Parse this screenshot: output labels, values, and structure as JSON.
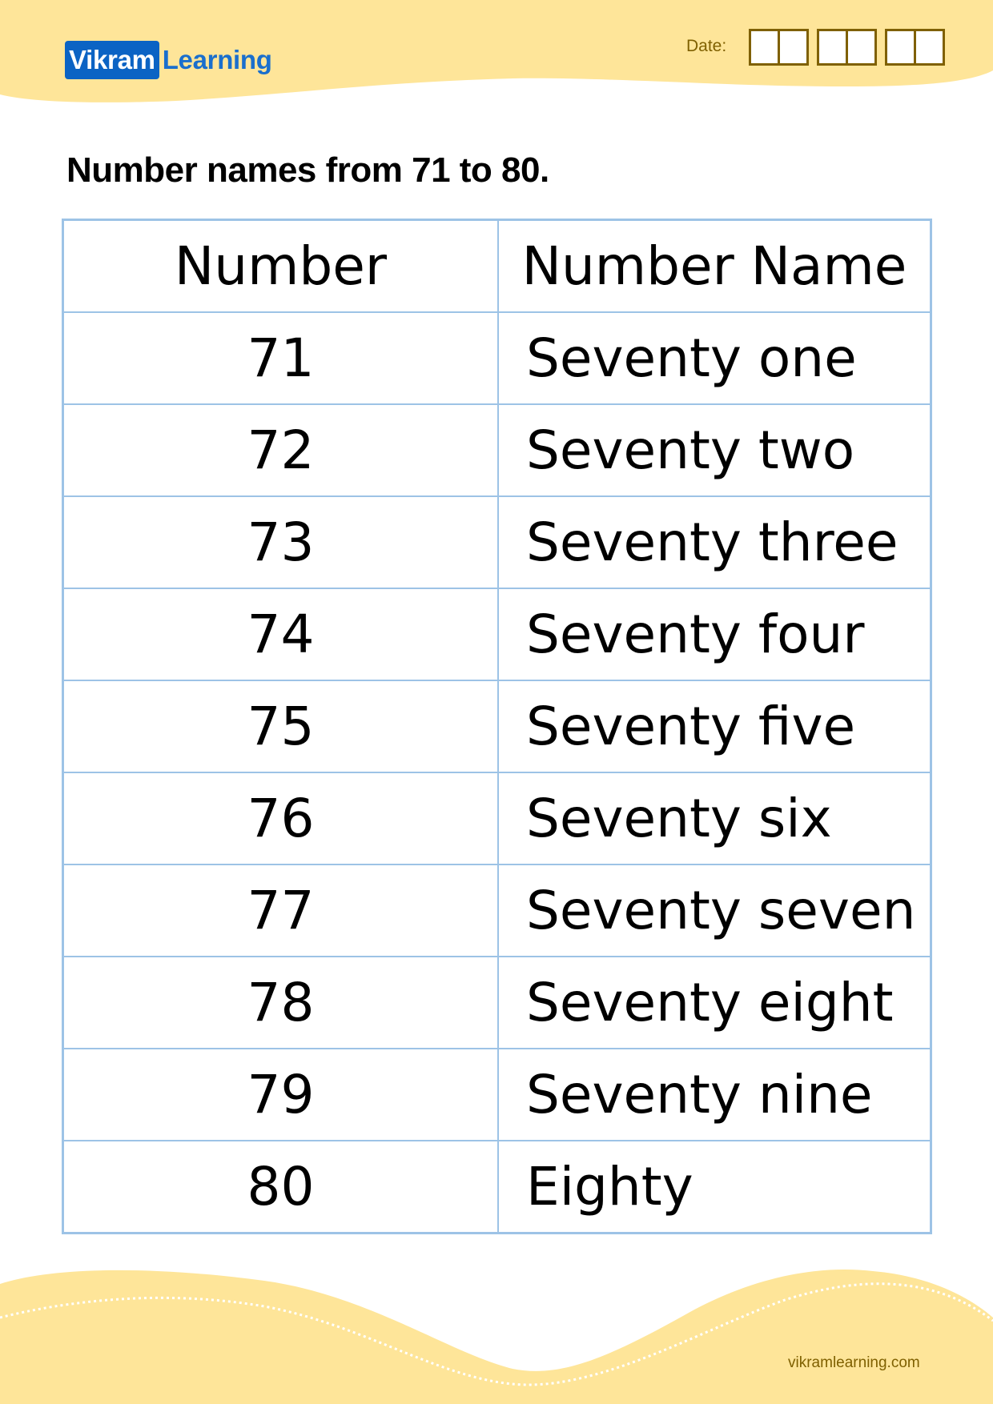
{
  "brand": {
    "logo_box_text": "Vikram",
    "logo_text": "Learning",
    "logo_box_color": "#0b63c4",
    "logo_text_color": "#1a6fcd"
  },
  "header": {
    "date_label": "Date:",
    "date_box_groups": 3,
    "date_boxes_per_group": 2
  },
  "worksheet": {
    "title": "Number names from 71 to 80."
  },
  "table": {
    "columns": [
      "Number",
      "Number Name"
    ],
    "rows": [
      {
        "number": "71",
        "name": "Seventy one"
      },
      {
        "number": "72",
        "name": "Seventy two"
      },
      {
        "number": "73",
        "name": "Seventy three"
      },
      {
        "number": "74",
        "name": "Seventy four"
      },
      {
        "number": "75",
        "name": "Seventy five"
      },
      {
        "number": "76",
        "name": "Seventy six"
      },
      {
        "number": "77",
        "name": "Seventy seven"
      },
      {
        "number": "78",
        "name": "Seventy eight"
      },
      {
        "number": "79",
        "name": "Seventy nine"
      },
      {
        "number": "80",
        "name": "Eighty"
      }
    ],
    "border_color": "#9dc3e6"
  },
  "footer": {
    "url_text": "vikramlearning.com"
  },
  "colors": {
    "wave_fill": "#fee599",
    "accent_brown": "#7f6000"
  }
}
